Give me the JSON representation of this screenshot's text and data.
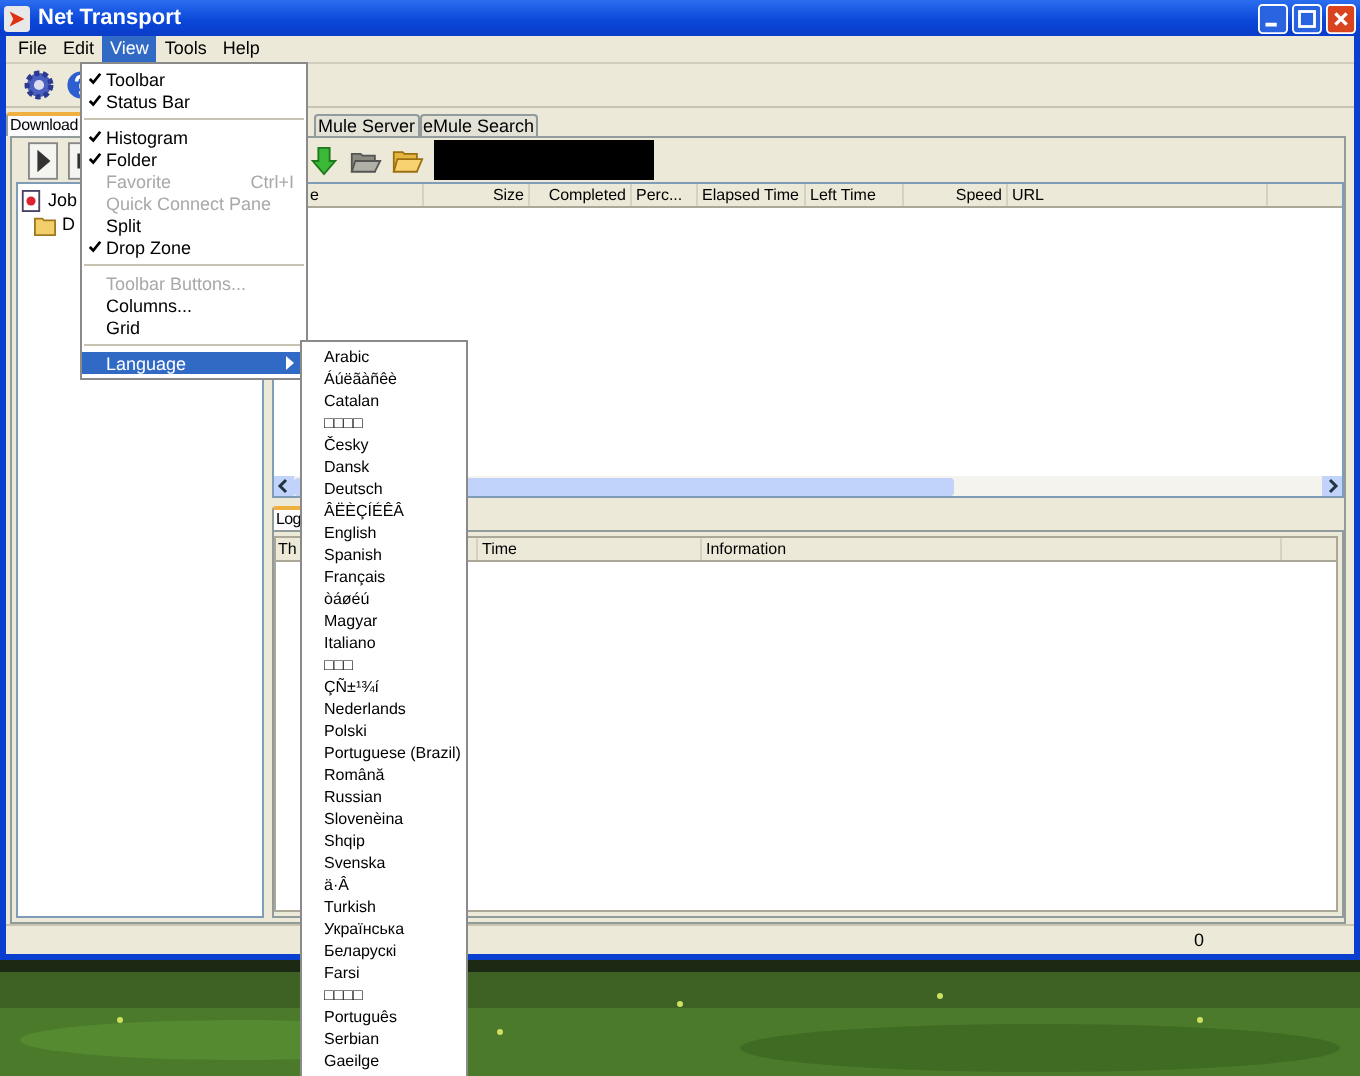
{
  "window": {
    "title": "Net Transport"
  },
  "menu_bar": [
    {
      "label": "File",
      "selected": false
    },
    {
      "label": "Edit",
      "selected": false
    },
    {
      "label": "View",
      "selected": true
    },
    {
      "label": "Tools",
      "selected": false
    },
    {
      "label": "Help",
      "selected": false
    }
  ],
  "view_menu": [
    {
      "kind": "item",
      "label": "Toolbar",
      "checked": true,
      "disabled": false
    },
    {
      "kind": "item",
      "label": "Status Bar",
      "checked": true,
      "disabled": false
    },
    {
      "kind": "separator"
    },
    {
      "kind": "item",
      "label": "Histogram",
      "checked": true,
      "disabled": false
    },
    {
      "kind": "item",
      "label": "Folder",
      "checked": true,
      "disabled": false
    },
    {
      "kind": "item",
      "label": "Favorite",
      "checked": false,
      "disabled": true,
      "shortcut": "Ctrl+I"
    },
    {
      "kind": "item",
      "label": "Quick Connect Pane",
      "checked": false,
      "disabled": true
    },
    {
      "kind": "item",
      "label": "Split",
      "checked": false,
      "disabled": false
    },
    {
      "kind": "item",
      "label": "Drop Zone",
      "checked": true,
      "disabled": false
    },
    {
      "kind": "separator"
    },
    {
      "kind": "item",
      "label": "Toolbar Buttons...",
      "checked": false,
      "disabled": true
    },
    {
      "kind": "item",
      "label": "Columns...",
      "checked": false,
      "disabled": false
    },
    {
      "kind": "item",
      "label": "Grid",
      "checked": false,
      "disabled": false
    },
    {
      "kind": "separator"
    },
    {
      "kind": "submenu",
      "label": "Language",
      "selected": true
    }
  ],
  "language_menu": [
    "Arabic",
    "Áúëãàñêè",
    "Catalan",
    "□□□□",
    "Česky",
    "Dansk",
    "Deutsch",
    "ÂËÈÇÍÉÊÂ",
    "English",
    "Spanish",
    "Français",
    "òáøéú",
    "Magyar",
    "Italiano",
    "□□□",
    "ÇÑ±¹¾í",
    "Nederlands",
    "Polski",
    "Portuguese (Brazil)",
    "Română",
    "Russian",
    "Slovenèina",
    "Shqip",
    "Svenska",
    "ä·Â",
    "Turkish",
    "Українська",
    "Беларускі",
    "Farsi",
    "□□□□",
    "Português",
    "Serbian",
    "Gaeilge"
  ],
  "tabs": [
    {
      "label": "Download",
      "selected": true
    },
    {
      "label": "Mule Server",
      "selected": false
    },
    {
      "label": "eMule Search",
      "selected": false
    }
  ],
  "tree": [
    {
      "label": "Job",
      "children": [
        {
          "label": "D"
        }
      ]
    }
  ],
  "columns": [
    "e",
    "Size",
    "Completed",
    "Perc...",
    "Elapsed Time",
    "Left Time",
    "Speed",
    "URL"
  ],
  "log_tab": {
    "label": "Log",
    "selected": true
  },
  "log_columns": [
    "Th",
    "Time",
    "Information"
  ],
  "status_bar": {
    "count": "0"
  }
}
